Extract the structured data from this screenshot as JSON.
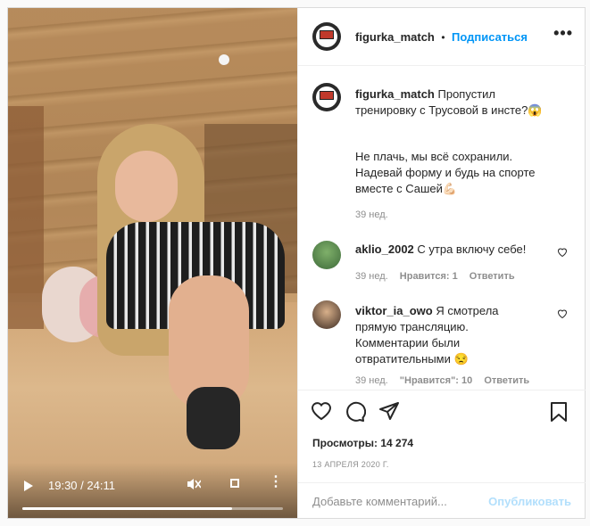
{
  "video": {
    "time": "19:30 / 24:11",
    "progress": 0.806
  },
  "post": {
    "username": "figurka_match",
    "separator": "•",
    "follow_label": "Подписаться",
    "more_label": "•••",
    "caption_line1": "Пропустил",
    "caption_line2": "тренировку с Трусовой в инсте?😱",
    "caption_p2_l1": "Не плачь, мы всё сохранили.",
    "caption_p2_l2": "Надевай форму и будь на спорте",
    "caption_p2_l3": "вместе с Сашей💪🏻",
    "caption_time": "39 нед."
  },
  "comments": [
    {
      "username": "aklio_2002",
      "text": "С утра включу себе!",
      "time": "39 нед.",
      "likes": "Нравится: 1",
      "reply": "Ответить"
    },
    {
      "username": "viktor_ia_owo",
      "text_l1": "Я смотрела",
      "text_l2": "прямую трансляцию.",
      "text_l3": "Комментарии были",
      "text_l4": "отвратительными 😒",
      "time": "39 нед.",
      "likes": "\"Нравится\": 10",
      "reply": "Ответить"
    }
  ],
  "stats": {
    "views": "Просмотры: 14 274",
    "date": "13 АПРЕЛЯ 2020 Г."
  },
  "composer": {
    "placeholder": "Добавьте комментарий...",
    "publish_label": "Опубликовать"
  },
  "icons": {
    "heart": "heart-icon",
    "comment": "comment-icon",
    "share": "share-icon",
    "save": "bookmark-icon",
    "play": "play-icon",
    "mute": "mute-icon",
    "fullscreen": "fullscreen-icon",
    "more": "more-icon"
  },
  "colors": {
    "accent": "#0095f6",
    "muted": "#8e8e8e",
    "publish_disabled": "#b2dffc"
  }
}
